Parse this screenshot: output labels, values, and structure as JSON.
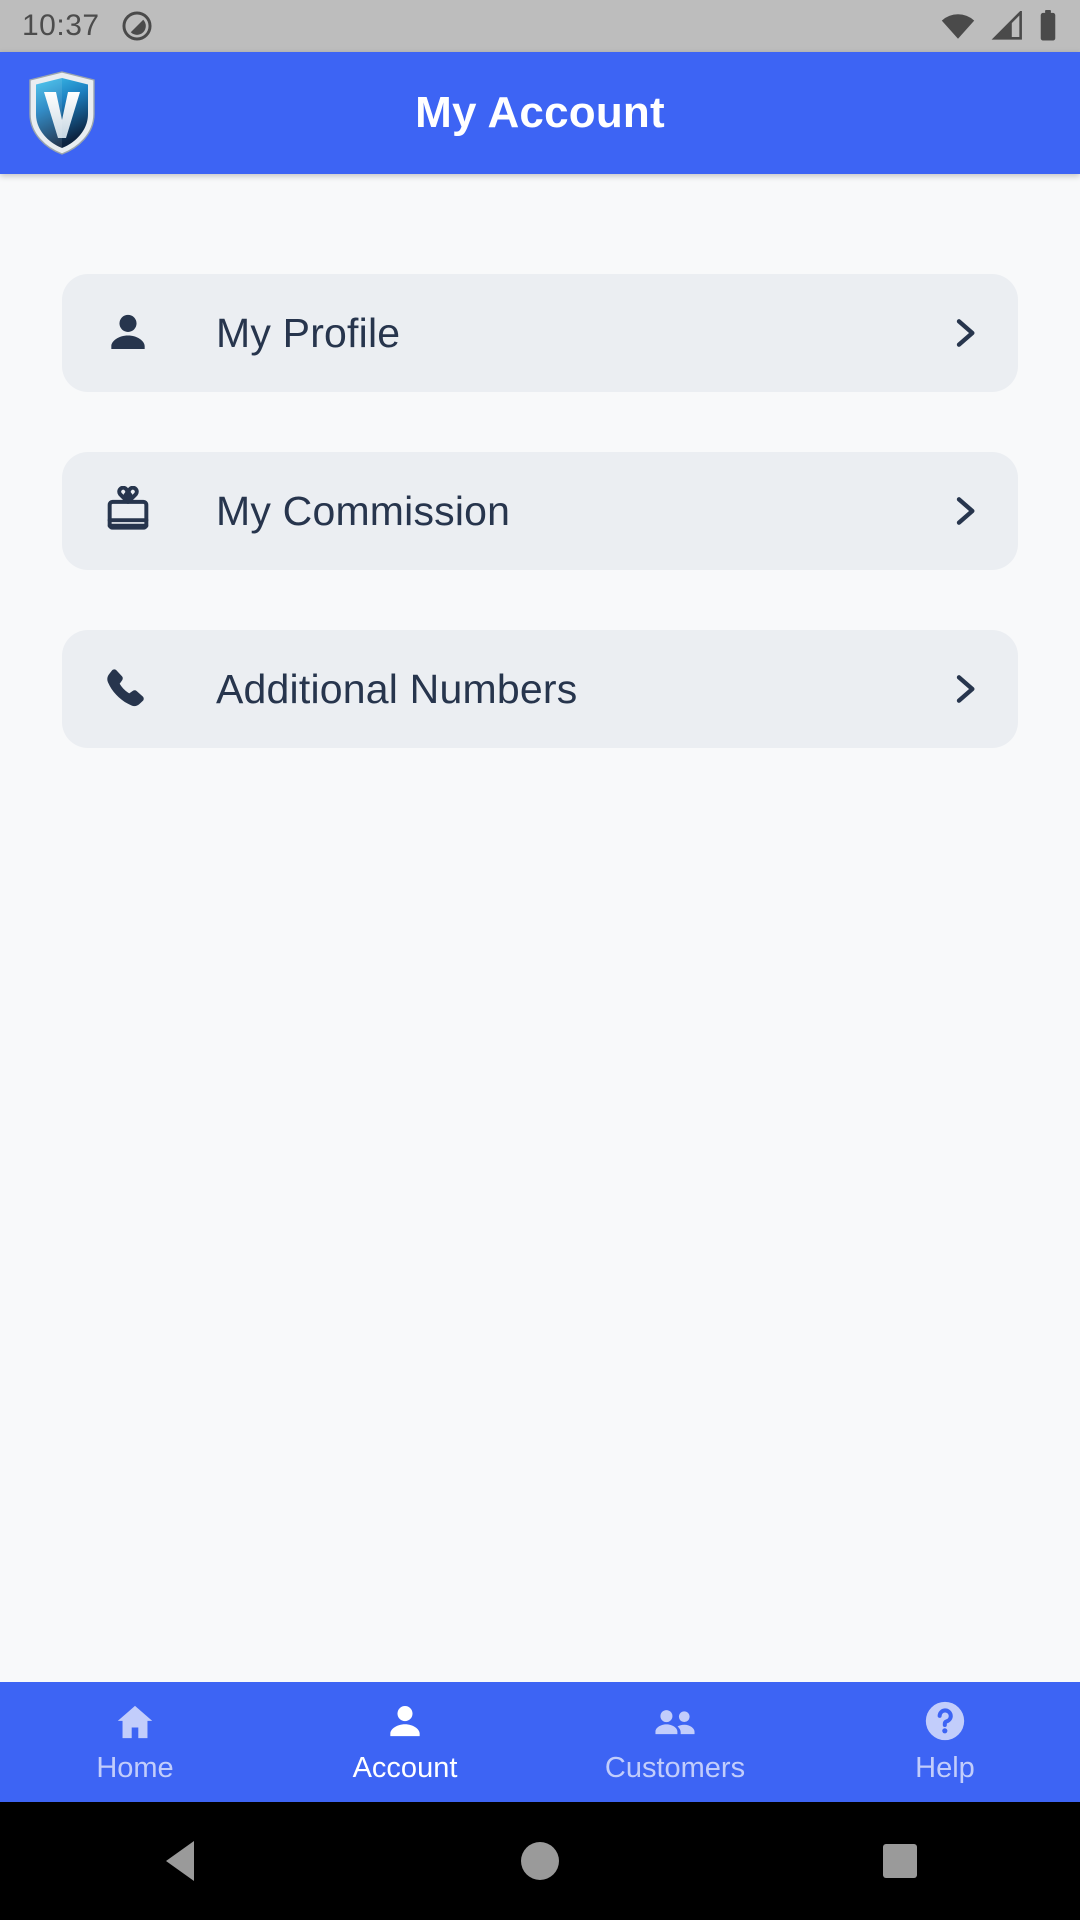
{
  "status_bar": {
    "time": "10:37",
    "icons": [
      "dnd-icon",
      "wifi-icon",
      "cellular-signal-icon",
      "battery-icon"
    ]
  },
  "app_bar": {
    "title": "My Account",
    "logo_name": "shield-v-logo",
    "background_color": "#3d64f4",
    "title_color": "#ffffff"
  },
  "menu": {
    "items": [
      {
        "label": "My Profile",
        "icon": "person-icon",
        "chevron": "chevron-right-icon"
      },
      {
        "label": "My Commission",
        "icon": "gift-icon",
        "chevron": "chevron-right-icon"
      },
      {
        "label": "Additional Numbers",
        "icon": "phone-icon",
        "chevron": "chevron-right-icon"
      }
    ],
    "card_color": "#ebeef2",
    "text_color": "#27354d"
  },
  "bottom_nav": {
    "active_index": 1,
    "items": [
      {
        "label": "Home",
        "icon": "home-icon"
      },
      {
        "label": "Account",
        "icon": "person-icon"
      },
      {
        "label": "Customers",
        "icon": "people-icon"
      },
      {
        "label": "Help",
        "icon": "help-circle-icon"
      }
    ],
    "background_color": "#3d64f4",
    "active_color": "#ffffff",
    "inactive_color": "#c2cdfb"
  },
  "system_nav": {
    "back": "back-triangle-icon",
    "home": "home-circle-icon",
    "recents": "recents-square-icon"
  }
}
